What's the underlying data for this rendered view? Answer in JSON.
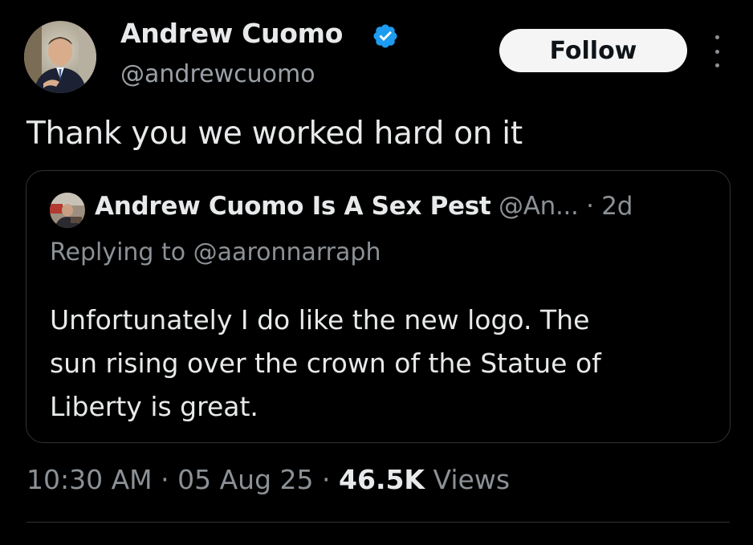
{
  "author": {
    "display_name": "Andrew Cuomo",
    "handle": "@andrewcuomo",
    "verified_icon": "verified-badge-icon",
    "avatar_icon": "profile-photo"
  },
  "actions": {
    "follow_label": "Follow",
    "more_icon": "more-options-icon"
  },
  "tweet": {
    "text": "Thank you we worked hard on it"
  },
  "quoted": {
    "display_name": "Andrew Cuomo Is A Sex Pest",
    "handle_and_time": " @An... · 2d",
    "reply_label": "Replying to ",
    "reply_handle": "@aaronnarraph",
    "lines": [
      "Unfortunately I do like the new logo. The",
      "sun rising over the crown of the Statue of",
      "Liberty is great."
    ]
  },
  "meta": {
    "time": "10:30 AM",
    "sep1": " · ",
    "date": "05 Aug 25",
    "sep2": " · ",
    "views_count": "46.5K",
    "views_label": " Views"
  },
  "colors": {
    "background": "#000000",
    "primary_text": "#e7e9ea",
    "secondary_text": "#8b9196",
    "verified_blue": "#1d9bf0",
    "follow_bg": "#f5f5f5",
    "border": "#2f3336"
  }
}
